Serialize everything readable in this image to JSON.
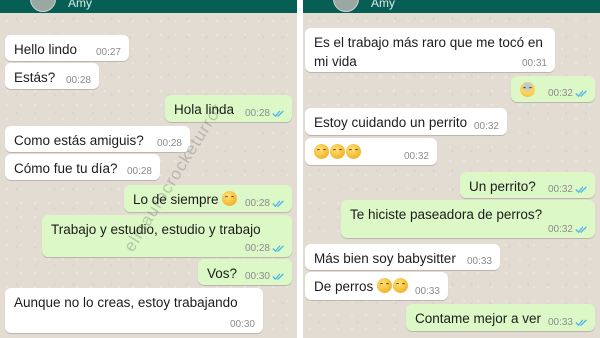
{
  "left": {
    "contact_name": "Amy",
    "messages": [
      {
        "text": "Hello lindo",
        "time": "00:27"
      },
      {
        "text": "Estás?",
        "time": "00:28"
      },
      {
        "text": "Hola linda",
        "time": "00:28"
      },
      {
        "text": "Como estás amiguis?",
        "time": "00:28"
      },
      {
        "text": "Cómo fue tu día?",
        "time": "00:28"
      },
      {
        "text": "Lo de siempre",
        "time": "00:28"
      },
      {
        "text": "Trabajo y estudio, estudio y trabajo",
        "time": "00:28"
      },
      {
        "text": "Vos?",
        "time": "00:30"
      },
      {
        "text": "Aunque no lo creas, estoy trabajando",
        "time": "00:30"
      }
    ]
  },
  "right": {
    "contact_name": "Amy",
    "messages": [
      {
        "text": "Es el trabajo más raro que me tocó en mi vida",
        "time": "00:31"
      },
      {
        "text": "",
        "time": "00:32"
      },
      {
        "text": "Estoy cuidando un perrito",
        "time": "00:32"
      },
      {
        "text": "",
        "time": "00:32"
      },
      {
        "text": "Un perrito?",
        "time": "00:32"
      },
      {
        "text": "Te hiciste paseadora de perros?",
        "time": "00:32"
      },
      {
        "text": "Más bien soy babysitter",
        "time": "00:33"
      },
      {
        "text": "De perros",
        "time": "00:33"
      },
      {
        "text": "Contame mejor a ver",
        "time": "00:33"
      }
    ]
  },
  "watermark": "elmaurocrocketurror",
  "colors": {
    "header": "#075e54",
    "incoming_bubble": "#ffffff",
    "outgoing_bubble": "#dcf8c6",
    "read_ticks": "#4fb6ec",
    "chat_background": "#e3dcd3"
  },
  "icons": {
    "read_receipt": "double-check-icon",
    "emoji_laugh": "laughing-tears-emoji",
    "emoji_scream": "screaming-face-emoji"
  }
}
